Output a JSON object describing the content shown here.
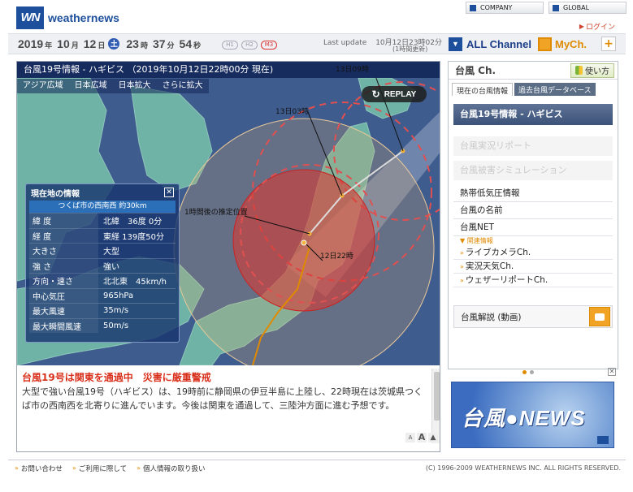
{
  "header": {
    "logo_text": "weathernews",
    "company_link": "COMPANY",
    "global_link": "GLOBAL",
    "login": "ログイン"
  },
  "datebar": {
    "year": "2019",
    "year_unit": "年",
    "month": "10",
    "month_unit": "月",
    "day": "12",
    "day_unit": "日",
    "weekday": "土",
    "hour": "23",
    "hour_unit": "時",
    "minute": "37",
    "minute_unit": "分",
    "second": "54",
    "second_unit": "秒",
    "badges": [
      "H1",
      "H2",
      "M3"
    ],
    "last_update_label": "Last update",
    "last_update_value": "10月12日23時02分",
    "last_update_sub": "(1時間更新)"
  },
  "nav": {
    "all_channel": "ALL Channel",
    "mych": "MyCh.",
    "plus": "+"
  },
  "map": {
    "title": "台風19号情報 - ハギビス （2019年10月12日22時00分 現在)",
    "tabs": [
      "アジア広域",
      "日本広域",
      "日本拡大",
      "さらに拡大"
    ],
    "replay": "REPLAY",
    "labels": {
      "l13d03": "13日03時",
      "l13d09": "13日09時",
      "one_hour": "1時間後の推定位置",
      "l12d22": "12日22時"
    }
  },
  "info_box": {
    "title": "現在地の情報",
    "location": "つくば市の西南西 約30km",
    "rows": [
      {
        "k": "緯 度",
        "v": "北緯　36度 0分"
      },
      {
        "k": "経 度",
        "v": "東経 139度50分"
      },
      {
        "k": "大きさ",
        "v": "大型"
      },
      {
        "k": "強 さ",
        "v": "強い"
      },
      {
        "k": "方向・速さ",
        "v": "北北東　45km/h"
      },
      {
        "k": "中心気圧",
        "v": "965hPa"
      },
      {
        "k": "最大風速",
        "v": "35m/s"
      },
      {
        "k": "最大瞬間風速",
        "v": "50m/s"
      }
    ]
  },
  "news": {
    "title": "台風19号は関東を通過中　災害に厳重警戒",
    "body": "大型で強い台風19号（ハギビス）は、19時前に静岡県の伊豆半島に上陸し、22時現在は茨城県つくば市の西南西を北寄りに進んでいます。今後は関東を通過して、三陸沖方面に進む予想です。",
    "tools": [
      "A",
      "A",
      "▲"
    ]
  },
  "right": {
    "title": "台風 Ch.",
    "usage": "使い方",
    "tab_current": "現在の台風情報",
    "tab_past": "過去台風データベース",
    "storm_item": "台風19号情報 - ハギビス",
    "disabled": [
      "台風実況リポート",
      "台風被害シミュレーション"
    ],
    "menu": [
      "熱帯低気圧情報",
      "台風の名前",
      "台風NET"
    ],
    "related_label": "関連情報",
    "related": [
      "ライブカメラCh.",
      "実況天気Ch.",
      "ウェザーリポートCh."
    ],
    "explain": "台風解説 (動画)"
  },
  "banner": {
    "text": "台風●NEWS"
  },
  "footer": {
    "links": [
      "お問い合わせ",
      "ご利用に際して",
      "個人情報の取り扱い"
    ],
    "copyright": "(C) 1996-2009 WEATHERNEWS INC. ALL RIGHTS RESERVED."
  },
  "colors": {
    "brand_blue": "#1d4f9c",
    "accent_orange": "#e08a00",
    "news_red": "#d9301c",
    "sea": "#3f5c8f",
    "land": "#6fb3a6",
    "storm_zone": "#d83a33"
  }
}
